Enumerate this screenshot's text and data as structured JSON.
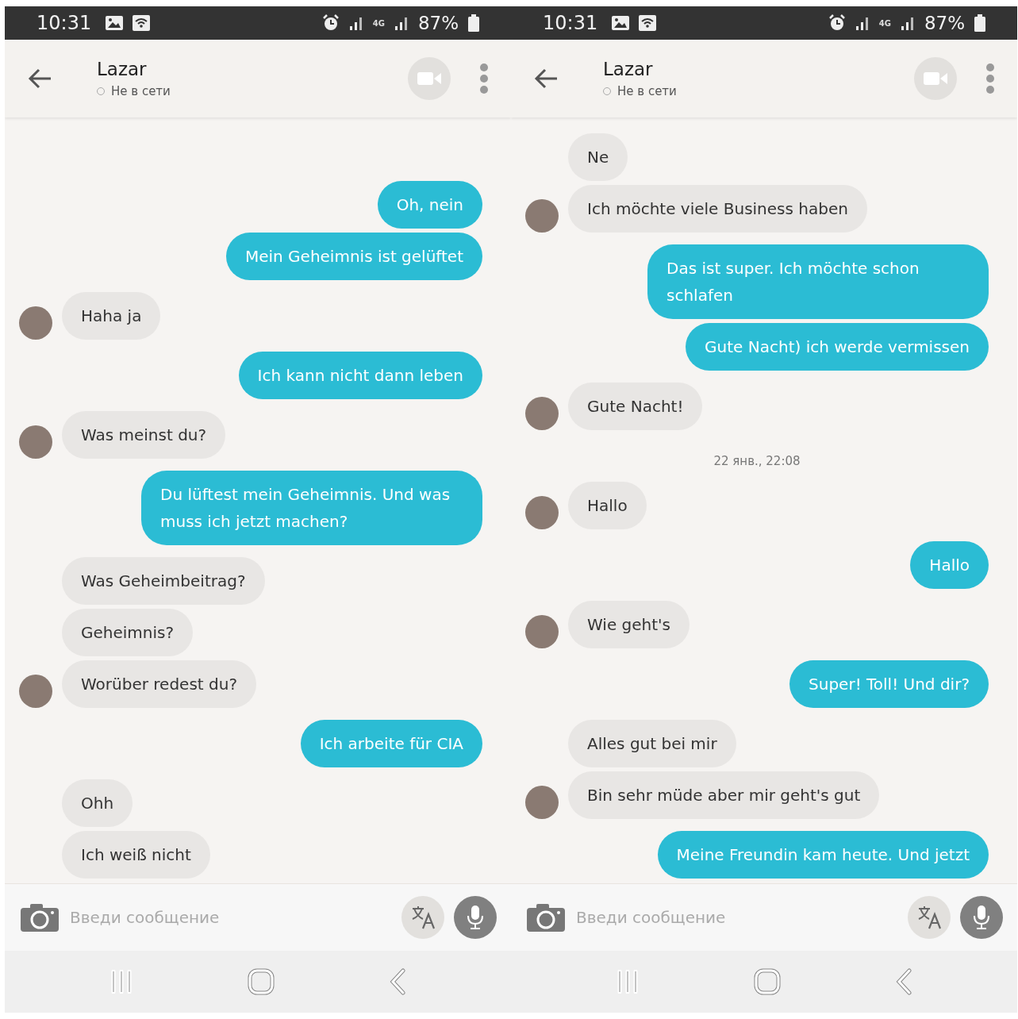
{
  "panels": [
    {
      "status_bar": {
        "time": "10:31",
        "network": "4G",
        "battery": "87%"
      },
      "header": {
        "name": "Lazar",
        "presence": "Не в сети",
        "online": false
      },
      "messages": [
        {
          "kind": "sent",
          "text": "Oh, nein"
        },
        {
          "kind": "sent",
          "text": "Mein Geheimnis ist gelüftet"
        },
        {
          "kind": "received",
          "text": "Haha ja",
          "avatar": true
        },
        {
          "kind": "sent",
          "text": "Ich kann nicht dann leben"
        },
        {
          "kind": "received",
          "text": "Was meinst du?",
          "avatar": true
        },
        {
          "kind": "sent",
          "text": "Du lüftest mein Geheimnis. Und was muss ich jetzt machen?"
        },
        {
          "kind": "received",
          "text": "Was Geheimbeitrag?",
          "avatar": false
        },
        {
          "kind": "received",
          "text": "Geheimnis?",
          "avatar": false
        },
        {
          "kind": "received",
          "text": "Worüber redest du?",
          "avatar": true
        },
        {
          "kind": "sent",
          "text": "Ich arbeite für CIA"
        },
        {
          "kind": "received",
          "text": "Ohh",
          "avatar": false
        },
        {
          "kind": "received",
          "text": "Ich weiß nicht",
          "avatar": false
        }
      ],
      "composer": {
        "placeholder": "Введи сообщение"
      }
    },
    {
      "status_bar": {
        "time": "10:31",
        "network": "4G",
        "battery": "87%"
      },
      "header": {
        "name": "Lazar",
        "presence": "Не в сети",
        "online": false
      },
      "messages": [
        {
          "kind": "received",
          "text": "Ne",
          "avatar": false
        },
        {
          "kind": "received",
          "text": "Ich möchte viele Business haben",
          "avatar": true
        },
        {
          "kind": "sent",
          "text": "Das ist super. Ich möchte schon schlafen"
        },
        {
          "kind": "sent",
          "text": "Gute Nacht) ich werde vermissen"
        },
        {
          "kind": "received",
          "text": "Gute Nacht!",
          "avatar": true
        },
        {
          "kind": "time",
          "text": "22 янв., 22:08"
        },
        {
          "kind": "received",
          "text": "Hallo",
          "avatar": true
        },
        {
          "kind": "sent",
          "text": "Hallo"
        },
        {
          "kind": "received",
          "text": "Wie geht's",
          "avatar": true
        },
        {
          "kind": "sent",
          "text": "Super! Toll! Und dir?"
        },
        {
          "kind": "received",
          "text": "Alles gut bei mir",
          "avatar": false
        },
        {
          "kind": "received",
          "text": "Bin sehr müde aber mir geht's gut",
          "avatar": true
        },
        {
          "kind": "sent",
          "text": "Meine Freundin kam heute. Und jetzt"
        }
      ],
      "composer": {
        "placeholder": "Введи сообщение"
      }
    }
  ]
}
